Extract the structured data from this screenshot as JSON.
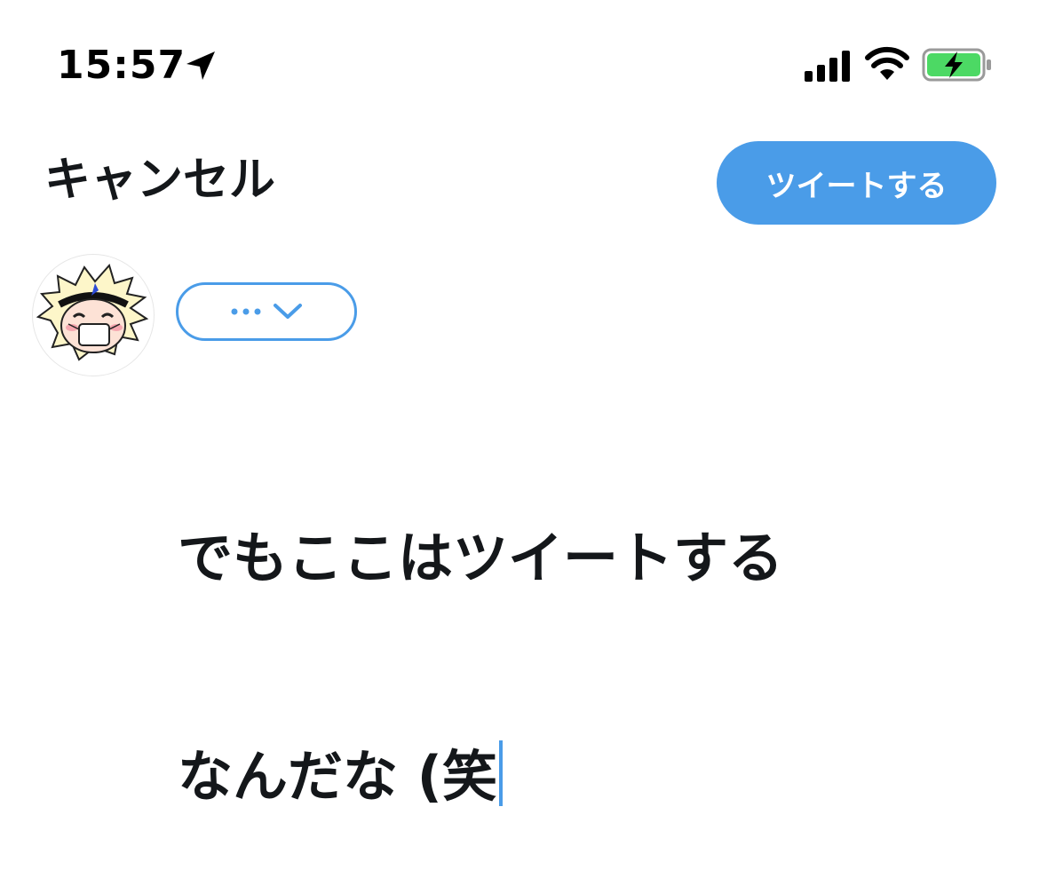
{
  "status_bar": {
    "time": "15:57",
    "icons": [
      "location-arrow-icon",
      "cellular-signal-icon",
      "wifi-icon",
      "battery-charging-icon"
    ]
  },
  "header": {
    "cancel_label": "キャンセル",
    "tweet_label": "ツイートする"
  },
  "audience": {
    "icons": [
      "more-dots-icon",
      "chevron-down-icon"
    ]
  },
  "compose": {
    "line1": "でもここはツイートする",
    "line2": "なんだな (笑"
  },
  "colors": {
    "accent": "#4a9ce8",
    "text": "#14171a",
    "battery_fill": "#4cd964",
    "background": "#ffffff"
  }
}
